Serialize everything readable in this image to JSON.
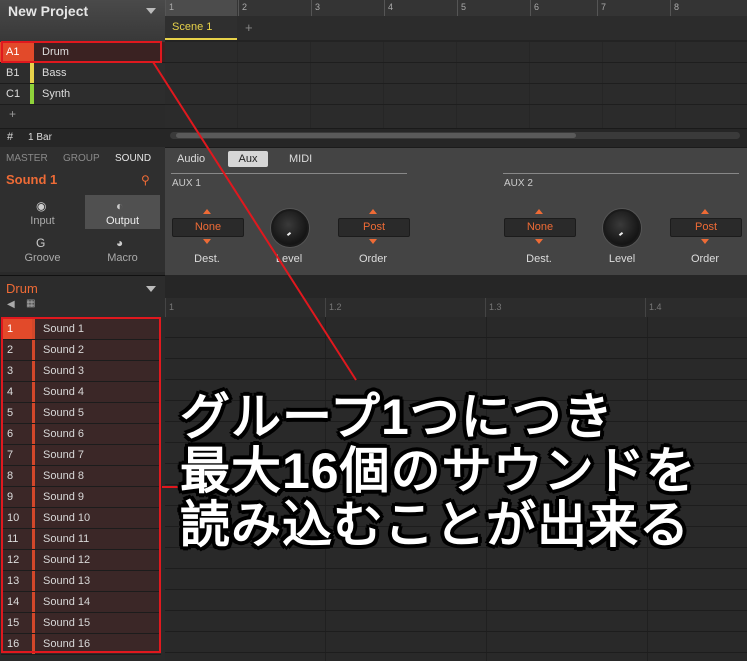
{
  "project": {
    "title": "New Project"
  },
  "groups": [
    {
      "id": "A1",
      "name": "Drum",
      "color": "#e24a2a"
    },
    {
      "id": "B1",
      "name": "Bass",
      "color": "#e7d24a"
    },
    {
      "id": "C1",
      "name": "Synth",
      "color": "#8fd23a"
    }
  ],
  "group_add": "+",
  "arranger": {
    "bar_numbers": [
      "1",
      "2",
      "3",
      "4",
      "5",
      "6",
      "7",
      "8"
    ],
    "scene": "Scene 1",
    "scene_add": "+",
    "length_label": "1 Bar"
  },
  "control": {
    "tabs": [
      "MASTER",
      "GROUP",
      "SOUND"
    ],
    "sound_name": "Sound 1",
    "modes": [
      "Input",
      "Output",
      "Groove",
      "Macro"
    ],
    "page_tabs": [
      "Audio",
      "Aux",
      "MIDI"
    ],
    "aux1": {
      "title": "AUX 1",
      "dest": "None",
      "order": "Post"
    },
    "aux2": {
      "title": "AUX 2",
      "dest": "None",
      "order": "Post"
    },
    "labels": {
      "dest": "Dest.",
      "level": "Level",
      "order": "Order"
    }
  },
  "pattern": {
    "group_name": "Drum",
    "ruler": [
      "1",
      "1.2",
      "1.3",
      "1.4"
    ]
  },
  "sounds": [
    {
      "num": "1",
      "name": "Sound 1"
    },
    {
      "num": "2",
      "name": "Sound 2"
    },
    {
      "num": "3",
      "name": "Sound 3"
    },
    {
      "num": "4",
      "name": "Sound 4"
    },
    {
      "num": "5",
      "name": "Sound 5"
    },
    {
      "num": "6",
      "name": "Sound 6"
    },
    {
      "num": "7",
      "name": "Sound 7"
    },
    {
      "num": "8",
      "name": "Sound 8"
    },
    {
      "num": "9",
      "name": "Sound 9"
    },
    {
      "num": "10",
      "name": "Sound 10"
    },
    {
      "num": "11",
      "name": "Sound 11"
    },
    {
      "num": "12",
      "name": "Sound 12"
    },
    {
      "num": "13",
      "name": "Sound 13"
    },
    {
      "num": "14",
      "name": "Sound 14"
    },
    {
      "num": "15",
      "name": "Sound 15"
    },
    {
      "num": "16",
      "name": "Sound 16"
    }
  ],
  "annotation": {
    "lines": [
      "グループ1つにつき",
      "最大16個のサウンドを",
      "読み込むことが出来る"
    ]
  },
  "colors": {
    "accent": "#ee6b36",
    "highlight": "#e0181e",
    "scene": "#e7d24a"
  }
}
